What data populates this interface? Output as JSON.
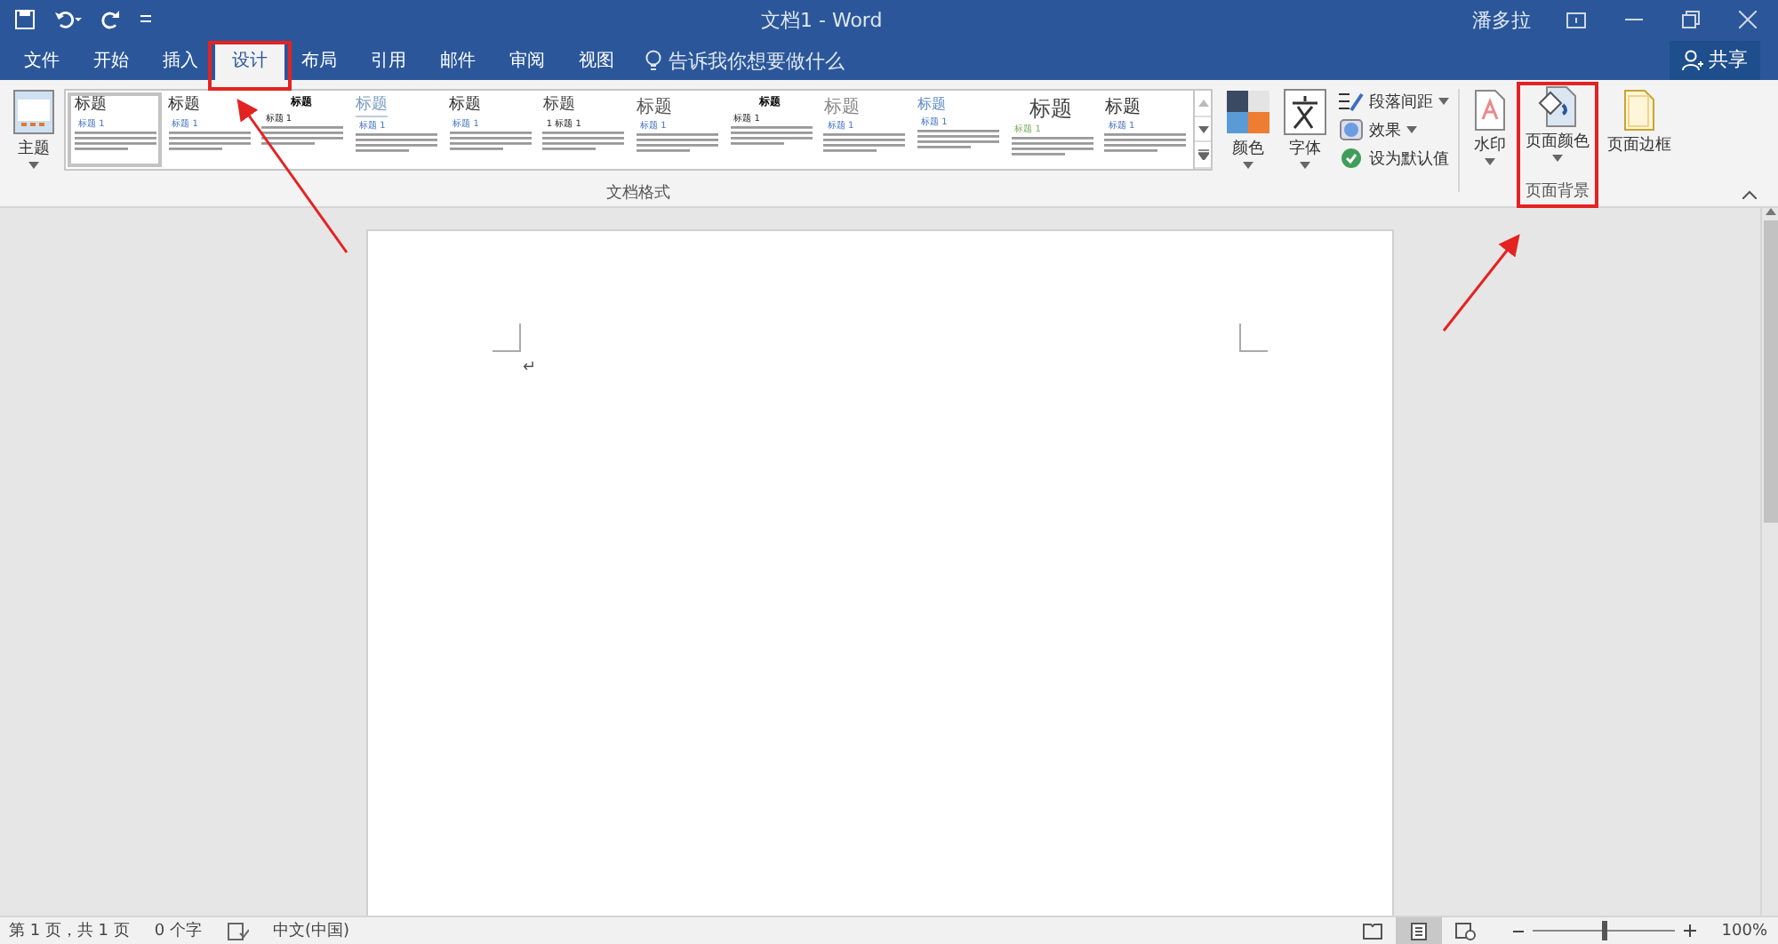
{
  "window": {
    "title": "文档1 - Word",
    "user": "潘多拉"
  },
  "tabs": [
    {
      "label": "文件",
      "selected": false
    },
    {
      "label": "开始",
      "selected": false
    },
    {
      "label": "插入",
      "selected": false
    },
    {
      "label": "设计",
      "selected": true
    },
    {
      "label": "布局",
      "selected": false
    },
    {
      "label": "引用",
      "selected": false
    },
    {
      "label": "邮件",
      "selected": false
    },
    {
      "label": "审阅",
      "selected": false
    },
    {
      "label": "视图",
      "selected": false
    }
  ],
  "tell_me": {
    "placeholder": "告诉我你想要做什么"
  },
  "share_button": "共享",
  "ribbon": {
    "theme_button": "主题",
    "style_gallery": [
      {
        "title": "标题",
        "heading": "标题 1",
        "selected": true
      },
      {
        "title": "标题",
        "heading": "标题 1",
        "selected": false
      },
      {
        "title": "标题",
        "heading": "标题 1",
        "selected": false
      },
      {
        "title": "标题",
        "heading": "标题 1",
        "selected": false
      },
      {
        "title": "标题",
        "heading": "标题 1",
        "selected": false
      },
      {
        "title": "标题",
        "heading": "1 标题 1",
        "selected": false
      },
      {
        "title": "标题",
        "heading": "标题 1",
        "selected": false
      },
      {
        "title": "标题",
        "heading": "标题 1",
        "selected": false
      },
      {
        "title": "标题",
        "heading": "标题 1",
        "selected": false
      },
      {
        "title": "标题",
        "heading": "标题 1",
        "selected": false
      },
      {
        "title": "标题",
        "heading": "标题 1",
        "selected": false
      },
      {
        "title": "标题",
        "heading": "标题 1",
        "selected": false
      }
    ],
    "colors_button": "颜色",
    "fonts_button": "字体",
    "small_buttons": [
      {
        "kind": "spacing",
        "label": "段落间距"
      },
      {
        "kind": "effects",
        "label": "效果"
      },
      {
        "kind": "default",
        "label": "设为默认值"
      }
    ],
    "document_formatting_label": "文档格式",
    "page_background": {
      "buttons": [
        {
          "kind": "watermark",
          "label": "水印"
        },
        {
          "kind": "color",
          "label": "页面颜色"
        },
        {
          "kind": "border",
          "label": "页面边框"
        }
      ],
      "label": "页面背景"
    }
  },
  "document": {
    "paragraph_mark": "↵"
  },
  "status_bar": {
    "page": "第 1 页，共 1 页",
    "words": "0 个字",
    "language": "中文(中国)",
    "views": [
      {
        "kind": "read",
        "selected": false
      },
      {
        "kind": "print",
        "selected": true
      },
      {
        "kind": "web",
        "selected": false
      }
    ],
    "zoom_slider": {
      "level": 0.5
    },
    "zoom": "100%"
  }
}
